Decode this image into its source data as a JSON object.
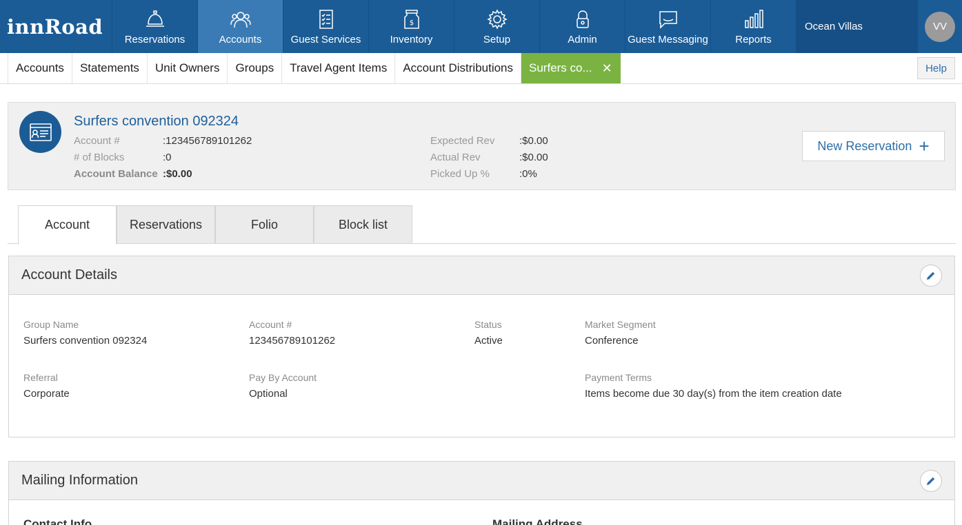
{
  "brand": {
    "logo": "innRoad"
  },
  "topnav": {
    "items": [
      {
        "label": "Reservations",
        "icon": "bell-icon"
      },
      {
        "label": "Accounts",
        "icon": "users-icon"
      },
      {
        "label": "Guest Services",
        "icon": "checklist-icon"
      },
      {
        "label": "Inventory",
        "icon": "money-jar-icon"
      },
      {
        "label": "Setup",
        "icon": "gear-icon"
      },
      {
        "label": "Admin",
        "icon": "lock-icon"
      },
      {
        "label": "Guest Messaging",
        "icon": "chat-icon"
      },
      {
        "label": "Reports",
        "icon": "bar-chart-icon"
      }
    ],
    "active": "Accounts",
    "property": "Ocean Villas",
    "avatar_initials": "VV"
  },
  "subnav": {
    "tabs": [
      "Accounts",
      "Statements",
      "Unit Owners",
      "Groups",
      "Travel Agent Items",
      "Account Distributions"
    ],
    "active_tab": "Surfers co...",
    "help": "Help"
  },
  "account": {
    "title": "Surfers convention 092324",
    "left": [
      {
        "label": "Account #",
        "value": ":123456789101262"
      },
      {
        "label": "# of Blocks",
        "value": ":0"
      },
      {
        "label": "Account Balance",
        "value": ":$0.00"
      }
    ],
    "right": [
      {
        "label": "Expected Rev",
        "value": ":$0.00"
      },
      {
        "label": "Actual Rev",
        "value": ":$0.00"
      },
      {
        "label": "Picked Up %",
        "value": ":0%"
      }
    ],
    "new_reservation": "New Reservation"
  },
  "content_tabs": [
    "Account",
    "Reservations",
    "Folio",
    "Block list"
  ],
  "account_details": {
    "title": "Account Details",
    "fields": [
      {
        "label": "Group Name",
        "value": "Surfers convention 092324"
      },
      {
        "label": "Account #",
        "value": "123456789101262"
      },
      {
        "label": "Status",
        "value": "Active"
      },
      {
        "label": "Market Segment",
        "value": "Conference"
      },
      {
        "label": "Referral",
        "value": "Corporate"
      },
      {
        "label": "Pay By Account",
        "value": "Optional"
      },
      {
        "label": "Payment Terms",
        "value": "Items become due 30 day(s) from the item creation date"
      }
    ]
  },
  "mailing": {
    "title": "Mailing Information",
    "contact_info": "Contact Info",
    "mailing_address": "Mailing Address"
  },
  "colors": {
    "nav_bg": "#1b5c96",
    "nav_active": "#3a7bb5",
    "tab_active_green": "#7ab342",
    "link_blue": "#2d6ea8"
  }
}
